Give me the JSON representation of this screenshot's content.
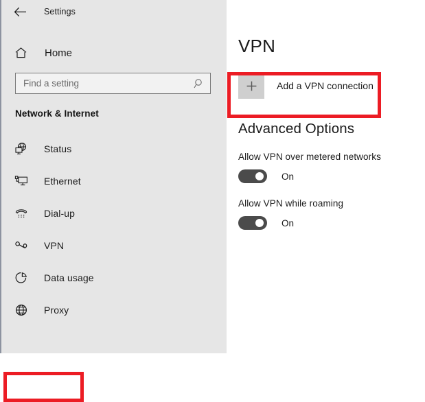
{
  "window": {
    "app_title": "Settings",
    "back_icon": "back-arrow-icon"
  },
  "sidebar": {
    "home": {
      "label": "Home",
      "icon": "home-icon"
    },
    "search": {
      "value": "",
      "placeholder": "Find a setting",
      "icon": "search-icon"
    },
    "category": "Network & Internet",
    "items": [
      {
        "label": "Status",
        "icon": "status-globe-monitor-icon",
        "selected": false
      },
      {
        "label": "Ethernet",
        "icon": "ethernet-monitor-icon",
        "selected": false
      },
      {
        "label": "Dial-up",
        "icon": "dialup-phone-icon",
        "selected": false
      },
      {
        "label": "VPN",
        "icon": "vpn-key-icon",
        "selected": true
      },
      {
        "label": "Data usage",
        "icon": "data-usage-pie-icon",
        "selected": false
      },
      {
        "label": "Proxy",
        "icon": "proxy-globe-icon",
        "selected": false
      }
    ]
  },
  "main": {
    "page_title": "VPN",
    "add_connection": {
      "label": "Add a VPN connection",
      "icon": "plus-icon"
    },
    "advanced_heading": "Advanced Options",
    "toggles": [
      {
        "caption": "Allow VPN over metered networks",
        "state": "On",
        "on": true
      },
      {
        "caption": "Allow VPN while roaming",
        "state": "On",
        "on": true
      }
    ]
  },
  "annotations": {
    "highlight_color": "#ec1c24",
    "boxes": [
      {
        "target": "sidebar-item-vpn"
      },
      {
        "target": "add-vpn-connection-button"
      }
    ]
  }
}
